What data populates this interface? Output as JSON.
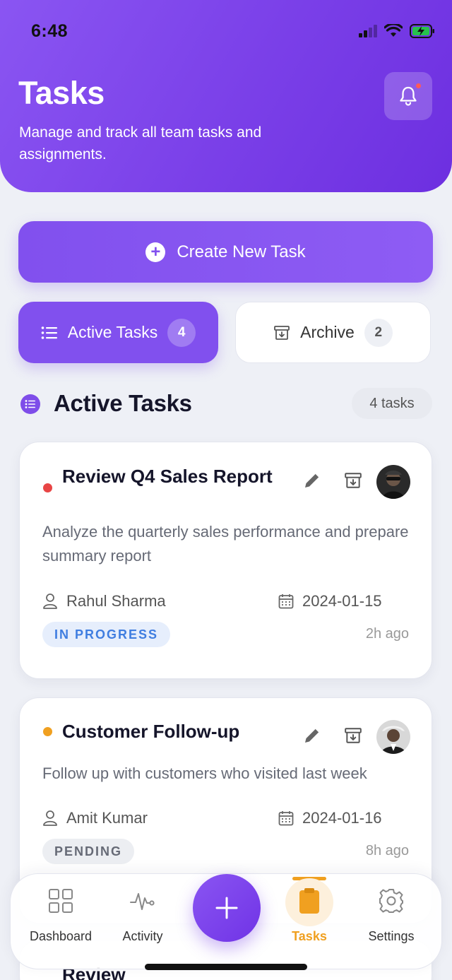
{
  "status_bar": {
    "time": "6:48"
  },
  "header": {
    "title": "Tasks",
    "subtitle": "Manage and track all team tasks and assignments."
  },
  "actions": {
    "create_label": "Create New Task"
  },
  "segments": {
    "active": {
      "label": "Active Tasks",
      "count": "4"
    },
    "archive": {
      "label": "Archive",
      "count": "2"
    }
  },
  "section": {
    "title": "Active Tasks",
    "count_label": "4 tasks"
  },
  "tasks": [
    {
      "title": "Review Q4 Sales Report",
      "description": "Analyze the quarterly sales performance and prepare summary report",
      "assignee": "Rahul Sharma",
      "date": "2024-01-15",
      "status": "IN PROGRESS",
      "time_ago": "2h ago",
      "priority_color": "#e84545"
    },
    {
      "title": "Customer Follow-up",
      "description": "Follow up with customers who visited last week",
      "assignee": "Amit Kumar",
      "date": "2024-01-16",
      "status": "PENDING",
      "time_ago": "8h ago",
      "priority_color": "#f0a020"
    },
    {
      "title": "Review"
    }
  ],
  "tab_bar": {
    "items": [
      {
        "label": "Dashboard",
        "icon": "grid-icon"
      },
      {
        "label": "Activity",
        "icon": "pulse-icon"
      },
      {
        "label": "Tasks",
        "icon": "clipboard-icon",
        "active": true
      },
      {
        "label": "Settings",
        "icon": "gear-icon"
      }
    ]
  },
  "colors": {
    "accent": "#8150ee",
    "active_tab": "#f0a020",
    "in_progress_bg": "#e6eefc",
    "in_progress_text": "#3f7de0",
    "pending_bg": "#eceef2",
    "pending_text": "#666a76"
  }
}
